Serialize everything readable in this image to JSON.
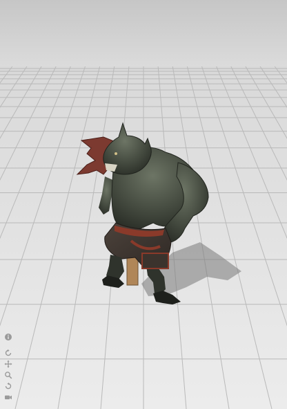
{
  "viewer": {
    "background_top": "#c8c8c8",
    "floor_color": "#e6e6e6",
    "grid_color": "#b9b9b9"
  },
  "model": {
    "subject": "werewolf-creature",
    "skin_color": "#4a5044",
    "cloth_color": "#8a3a2a"
  },
  "toolbar": {
    "icons": [
      "info-icon",
      "rotate-icon",
      "move-icon",
      "zoom-icon",
      "reset-view-icon",
      "camera-icon"
    ]
  }
}
